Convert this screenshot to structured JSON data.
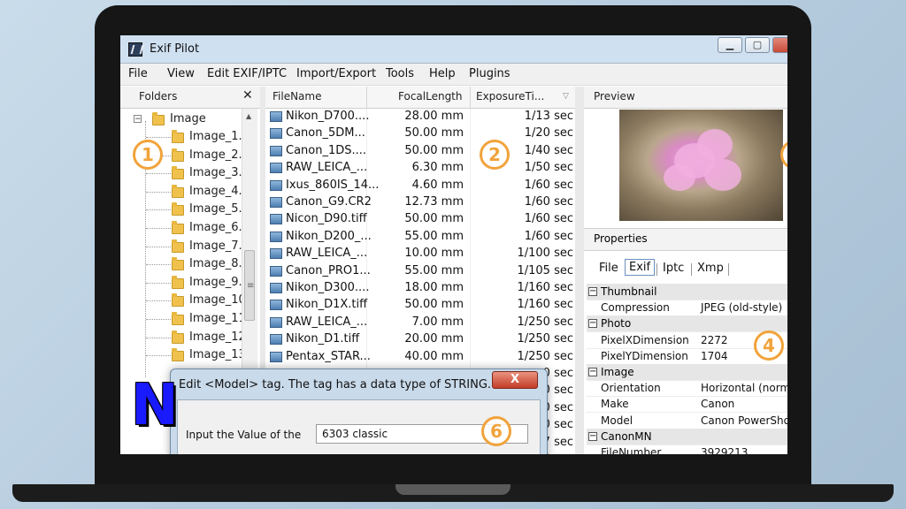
{
  "window": {
    "title": "Exif Pilot"
  },
  "menu": [
    "File",
    "View",
    "Edit EXIF/IPTC",
    "Import/Export",
    "Tools",
    "Help",
    "Plugins"
  ],
  "folders": {
    "header": "Folders",
    "close": "✕",
    "root": "Image",
    "expander": "−",
    "items": [
      "Image_1.",
      "Image_2.",
      "Image_3.",
      "Image_4.",
      "Image_5.",
      "Image_6.",
      "Image_7.",
      "Image_8.",
      "Image_9.",
      "Image_10",
      "Image_11",
      "Image_12",
      "Image_13"
    ]
  },
  "file_list": {
    "columns": [
      "FileName",
      "FocalLength",
      "ExposureTi..."
    ],
    "rows": [
      {
        "name": "Nikon_D700....",
        "focal": "28.00 mm",
        "exposure": "1/13 sec"
      },
      {
        "name": "Canon_5DM...",
        "focal": "50.00 mm",
        "exposure": "1/20 sec"
      },
      {
        "name": "Canon_1DS....",
        "focal": "50.00 mm",
        "exposure": "1/40 sec"
      },
      {
        "name": "RAW_LEICA_...",
        "focal": "6.30 mm",
        "exposure": "1/50 sec"
      },
      {
        "name": "Ixus_860IS_14...",
        "focal": "4.60 mm",
        "exposure": "1/60 sec"
      },
      {
        "name": "Canon_G9.CR2",
        "focal": "12.73 mm",
        "exposure": "1/60 sec"
      },
      {
        "name": "Nicon_D90.tiff",
        "focal": "50.00 mm",
        "exposure": "1/60 sec"
      },
      {
        "name": "Nikon_D200_...",
        "focal": "55.00 mm",
        "exposure": "1/60 sec"
      },
      {
        "name": "RAW_LEICA_...",
        "focal": "10.00 mm",
        "exposure": "1/100 sec"
      },
      {
        "name": "Canon_PRO1...",
        "focal": "55.00 mm",
        "exposure": "1/105 sec"
      },
      {
        "name": "Nikon_D300....",
        "focal": "18.00 mm",
        "exposure": "1/160 sec"
      },
      {
        "name": "Nikon_D1X.tiff",
        "focal": "50.00 mm",
        "exposure": "1/160 sec"
      },
      {
        "name": "RAW_LEICA_...",
        "focal": "7.00 mm",
        "exposure": "1/250 sec"
      },
      {
        "name": "Nikon_D1.tiff",
        "focal": "20.00 mm",
        "exposure": "1/250 sec"
      },
      {
        "name": "Pentax_STAR...",
        "focal": "40.00 mm",
        "exposure": "1/250 sec"
      }
    ],
    "partial_exposure": [
      "0 sec",
      "0 sec",
      "0 sec",
      "0 sec",
      "7 sec",
      "0 sec"
    ]
  },
  "preview": {
    "header": "Preview"
  },
  "properties": {
    "header": "Properties",
    "tabs": [
      "File",
      "Exif",
      "Iptc",
      "Xmp"
    ],
    "active_tab": "Exif",
    "rows": [
      {
        "section": "Thumbnail"
      },
      {
        "key": "Compression",
        "value": "JPEG (old-style)"
      },
      {
        "section": "Photo"
      },
      {
        "key": "PixelXDimension",
        "value": "2272"
      },
      {
        "key": "PixelYDimension",
        "value": "1704"
      },
      {
        "section": "Image"
      },
      {
        "key": "Orientation",
        "value": "Horizontal (normal"
      },
      {
        "key": "Make",
        "value": "Canon"
      },
      {
        "key": "Model",
        "value": "Canon PowerShot"
      },
      {
        "section": "CanonMN"
      },
      {
        "key": "FileNumber",
        "value": "3929213"
      }
    ]
  },
  "dialog": {
    "title": "Edit <Model> tag. The tag has a data type of STRING.",
    "close": "X",
    "label": "Input the Value of the",
    "value": "6303 classic"
  },
  "callouts": [
    "1",
    "2",
    "4",
    "6"
  ],
  "logo": "N",
  "colors": {
    "accent": "#f1a33b",
    "title_bar": "#cfe0f1",
    "logo": "#1a1aff"
  }
}
